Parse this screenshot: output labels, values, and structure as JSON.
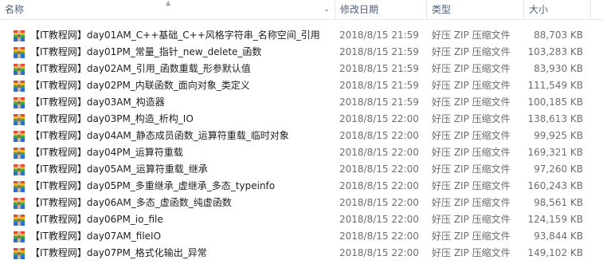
{
  "columns": {
    "name": "名称",
    "date": "修改日期",
    "type": "类型",
    "size": "大小"
  },
  "icons": {
    "sort": "sort-ascending-icon",
    "chevron": "chevron-down-icon",
    "file": "zip-archive-icon"
  },
  "files": [
    {
      "name": "【IT教程网】day01AM_C++基础_C++风格字符串_名称空间_引用",
      "date": "2018/8/15 21:59",
      "type": "好压 ZIP 压缩文件",
      "size": "88,703 KB"
    },
    {
      "name": "【IT教程网】day01PM_常量_指针_new_delete_函数",
      "date": "2018/8/15 21:59",
      "type": "好压 ZIP 压缩文件",
      "size": "103,283 KB"
    },
    {
      "name": "【IT教程网】day02AM_引用_函数重载_形参默认值",
      "date": "2018/8/15 21:59",
      "type": "好压 ZIP 压缩文件",
      "size": "83,930 KB"
    },
    {
      "name": "【IT教程网】day02PM_内联函数_面向对象_类定义",
      "date": "2018/8/15 21:59",
      "type": "好压 ZIP 压缩文件",
      "size": "111,549 KB"
    },
    {
      "name": "【IT教程网】day03AM_构造器",
      "date": "2018/8/15 21:59",
      "type": "好压 ZIP 压缩文件",
      "size": "100,185 KB"
    },
    {
      "name": "【IT教程网】day03PM_构造_析构_IO",
      "date": "2018/8/15 22:00",
      "type": "好压 ZIP 压缩文件",
      "size": "138,613 KB"
    },
    {
      "name": "【IT教程网】day04AM_静态成员函数_运算符重载_临时对象",
      "date": "2018/8/15 22:00",
      "type": "好压 ZIP 压缩文件",
      "size": "99,925 KB"
    },
    {
      "name": "【IT教程网】day04PM_运算符重载",
      "date": "2018/8/15 22:00",
      "type": "好压 ZIP 压缩文件",
      "size": "169,321 KB"
    },
    {
      "name": "【IT教程网】day05AM_运算符重载_继承",
      "date": "2018/8/15 22:00",
      "type": "好压 ZIP 压缩文件",
      "size": "97,260 KB"
    },
    {
      "name": "【IT教程网】day05PM_多重继承_虚继承_多态_typeinfo",
      "date": "2018/8/15 22:00",
      "type": "好压 ZIP 压缩文件",
      "size": "160,243 KB"
    },
    {
      "name": "【IT教程网】day06AM_多态_虚函数_纯虚函数",
      "date": "2018/8/15 22:00",
      "type": "好压 ZIP 压缩文件",
      "size": "98,561 KB"
    },
    {
      "name": "【IT教程网】day06PM_io_file",
      "date": "2018/8/15 22:00",
      "type": "好压 ZIP 压缩文件",
      "size": "124,159 KB"
    },
    {
      "name": "【IT教程网】day07AM_fileIO",
      "date": "2018/8/15 22:00",
      "type": "好压 ZIP 压缩文件",
      "size": "93,844 KB"
    },
    {
      "name": "【IT教程网】day07PM_格式化输出_异常",
      "date": "2018/8/15 22:00",
      "type": "好压 ZIP 压缩文件",
      "size": "149,102 KB"
    }
  ]
}
